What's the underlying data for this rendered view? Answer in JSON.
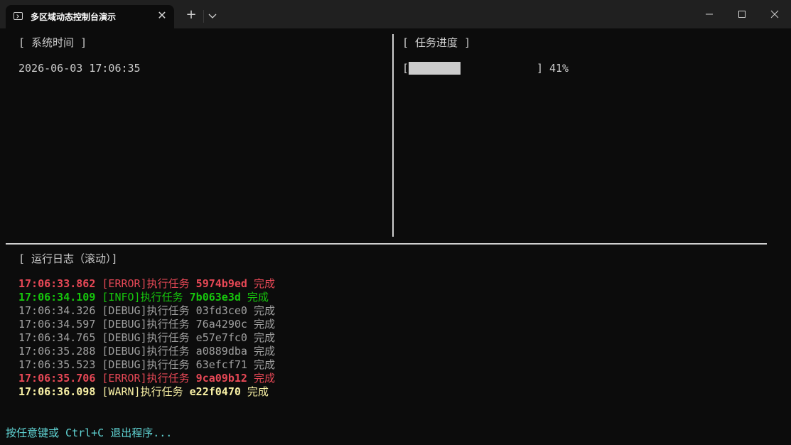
{
  "window": {
    "tab_title": "多区域动态控制台演示",
    "tab_close": "✕",
    "new_tab": "+"
  },
  "panes": {
    "time": {
      "title": "[ 系统时间 ]",
      "value": "2026-06-03 17:06:35"
    },
    "progress": {
      "title": "[ 任务进度 ]",
      "bracket_open": "[",
      "bracket_close": "]",
      "percent": 41,
      "percent_label": "41%"
    },
    "log": {
      "title": "[ 运行日志（滚动）]",
      "entries": [
        {
          "time": "17:06:33.862",
          "level": "[ERROR]",
          "action": "执行任务",
          "id": "5974b9ed",
          "status": "完成",
          "kind": "error"
        },
        {
          "time": "17:06:34.109",
          "level": "[INFO]",
          "action": "执行任务",
          "id": "7b063e3d",
          "status": "完成",
          "kind": "info"
        },
        {
          "time": "17:06:34.326",
          "level": "[DEBUG]",
          "action": "执行任务",
          "id": "03fd3ce0",
          "status": "完成",
          "kind": "debug"
        },
        {
          "time": "17:06:34.597",
          "level": "[DEBUG]",
          "action": "执行任务",
          "id": "76a4290c",
          "status": "完成",
          "kind": "debug"
        },
        {
          "time": "17:06:34.765",
          "level": "[DEBUG]",
          "action": "执行任务",
          "id": "e57e7fc0",
          "status": "完成",
          "kind": "debug"
        },
        {
          "time": "17:06:35.288",
          "level": "[DEBUG]",
          "action": "执行任务",
          "id": "a0889dba",
          "status": "完成",
          "kind": "debug"
        },
        {
          "time": "17:06:35.523",
          "level": "[DEBUG]",
          "action": "执行任务",
          "id": "63efcf71",
          "status": "完成",
          "kind": "debug"
        },
        {
          "time": "17:06:35.706",
          "level": "[ERROR]",
          "action": "执行任务",
          "id": "9ca09b12",
          "status": "完成",
          "kind": "error"
        },
        {
          "time": "17:06:36.098",
          "level": "[WARN]",
          "action": "执行任务",
          "id": "e22f0470",
          "status": "完成",
          "kind": "warn"
        }
      ]
    }
  },
  "footer": {
    "text": "按任意键或 Ctrl+C 退出程序..."
  },
  "colors": {
    "background": "#0c0c0c",
    "error": "#e74856",
    "info": "#16c60c",
    "debug": "#a0a0a0",
    "warn": "#f9f1a5",
    "footer": "#61d6d6"
  },
  "icons": [
    "terminal-icon",
    "close-icon",
    "plus-icon",
    "chevron-down-icon",
    "minimize-icon",
    "maximize-icon",
    "window-close-icon"
  ]
}
